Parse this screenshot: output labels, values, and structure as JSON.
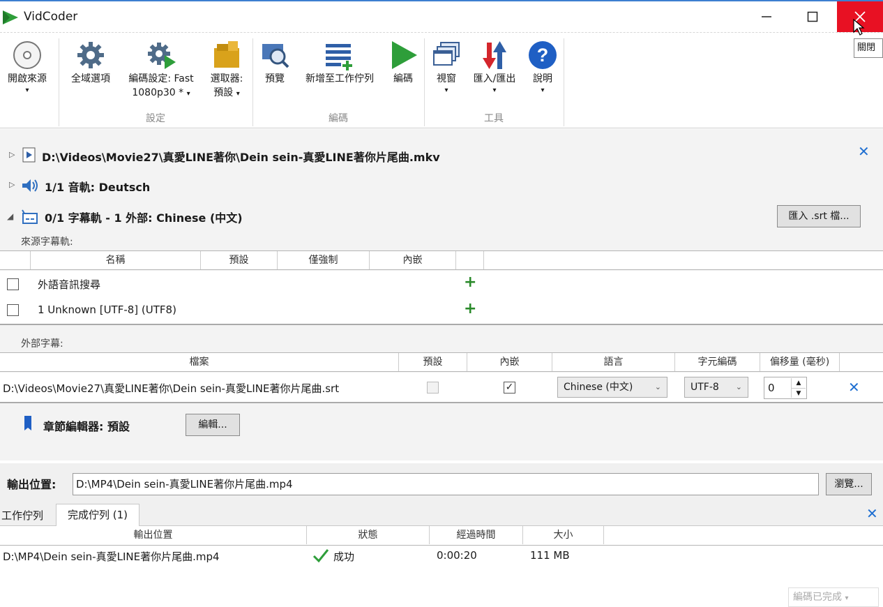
{
  "window": {
    "title": "VidCoder",
    "close_tooltip": "關閉"
  },
  "ribbon": {
    "open_source": "開啟來源",
    "global_options": "全域選項",
    "encoding_settings_line1": "編碼設定: Fast",
    "encoding_settings_line2": "1080p30 *",
    "picker_line1": "選取器:",
    "picker_line2": "預設",
    "preview": "預覽",
    "add_to_queue": "新增至工作佇列",
    "encode": "編碼",
    "window": "視窗",
    "import_export": "匯入/匯出",
    "help": "說明",
    "group_settings": "設定",
    "group_encode": "編碼",
    "group_tools": "工具",
    "dropdown_arrow": "▾"
  },
  "source": {
    "path": "D:\\Videos\\Movie27\\真愛LINE著你\\Dein sein-真愛LINE著你片尾曲.mkv",
    "audio": "1/1 音軌: Deutsch",
    "subtitles": "0/1 字幕軌 - 1 外部: Chinese (中文)",
    "import_srt_button": "匯入 .srt 檔..."
  },
  "source_subtitles": {
    "label": "來源字幕軌:",
    "columns": [
      "名稱",
      "預設",
      "僅強制",
      "內嵌"
    ],
    "rows": [
      "外語音訊搜尋",
      "1 Unknown [UTF-8] (UTF8)"
    ]
  },
  "external_subtitles": {
    "label": "外部字幕:",
    "columns": [
      "檔案",
      "預設",
      "內嵌",
      "語言",
      "字元編碼",
      "偏移量 (毫秒)"
    ],
    "row": {
      "file": "D:\\Videos\\Movie27\\真愛LINE著你\\Dein sein-真愛LINE著你片尾曲.srt",
      "language": "Chinese (中文)",
      "charset": "UTF-8",
      "offset": "0"
    }
  },
  "chapters": {
    "label": "章節編輯器: 預設",
    "edit_button": "編輯..."
  },
  "output": {
    "label": "輸出位置:",
    "value": "D:\\MP4\\Dein sein-真愛LINE著你片尾曲.mp4",
    "browse_button": "瀏覽..."
  },
  "queue": {
    "tabs": [
      "工作佇列",
      "完成佇列 (1)"
    ],
    "columns": [
      "輸出位置",
      "狀態",
      "經過時間",
      "大小"
    ],
    "rows": [
      {
        "output": "D:\\MP4\\Dein sein-真愛LINE著你片尾曲.mp4",
        "status": "成功",
        "elapsed": "0:00:20",
        "size": "111 MB"
      }
    ]
  },
  "status_bar": {
    "text": "編碼已完成"
  }
}
